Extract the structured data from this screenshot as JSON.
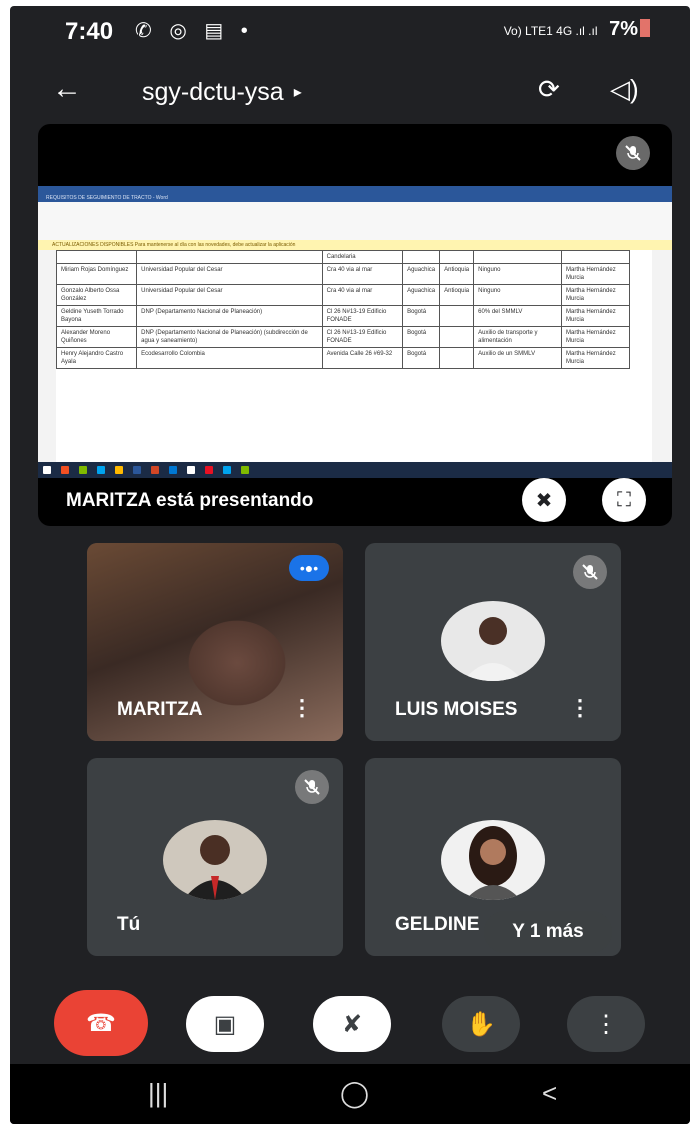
{
  "status_bar": {
    "time": "7:40",
    "left_icons": "✆ ◎ ▤ •",
    "network": "Vo) LTE1 4G .ıl .ıl",
    "battery": "7%"
  },
  "top_bar": {
    "meeting_code": "sgy-dctu-ysa",
    "code_arrow": "▸",
    "back_glyph": "←",
    "camera_switch_glyph": "⟳",
    "speaker_glyph": "◁)"
  },
  "presentation": {
    "label": "MARITZA está presentando",
    "shared_screen": {
      "ribbon_text": "REQUISITOS DE SEGUIMIENTO DE TRACTO - Word",
      "info_bar": "ACTUALIZACIONES DISPONIBLES  Para mantenerse al día con las novedades, debe actualizar la aplicación",
      "table_rows": [
        [
          "",
          "",
          "Candelaria",
          "",
          "",
          "",
          ""
        ],
        [
          "Miriam Rojas Domínguez",
          "Universidad Popular del Cesar",
          "Cra 40 via al mar",
          "Aguachica",
          "Antioquia",
          "Ninguno",
          "Martha Hernández Murcia"
        ],
        [
          "Gonzalo Alberto Ossa González",
          "Universidad Popular del Cesar",
          "Cra 40 via al mar",
          "Aguachica",
          "Antioquia",
          "Ninguno",
          "Martha Hernández Murcia"
        ],
        [
          "Geldine Yuseth Torrado Bayona",
          "DNP (Departamento Nacional de Planeación)",
          "Cl 26 N#13-19 Edificio FONADE",
          "Bogotá",
          "",
          "60% del SMMLV",
          "Martha Hernández Murcia"
        ],
        [
          "Alexander Moreno Quiñones",
          "DNP (Departamento Nacional de Planeación) (subdirección de agua y saneamiento)",
          "Cl 26 N#13-19 Edificio FONADE",
          "Bogotá",
          "",
          "Auxilio de transporte y alimentación",
          "Martha Hernández Murcia"
        ],
        [
          "Henry Alejandro Castro Ayala",
          "Ecodesarrollo Colombia",
          "Avenida Calle 26 #69-32",
          "Bogotá",
          "",
          "Auxilio de un SMMLV",
          "Martha Hernández Murcia"
        ]
      ]
    }
  },
  "participants": [
    {
      "name": "MARITZA",
      "muted": false,
      "speaking": true,
      "more_glyph": "⋮"
    },
    {
      "name": "LUIS MOISES",
      "muted": true,
      "speaking": false,
      "more_glyph": "⋮"
    },
    {
      "name": "Tú",
      "muted": true,
      "speaking": false,
      "more_glyph": ""
    },
    {
      "name": "GELDINE",
      "muted": false,
      "speaking": false,
      "more_glyph": ""
    }
  ],
  "more_participants": "Y 1 más",
  "controls": {
    "end_call": "☎",
    "camera": "▣",
    "mic": "✘",
    "raise_hand": "✋",
    "more": "⋮"
  },
  "nav_bar": {
    "recents": "|||",
    "home": "◯",
    "back": "<"
  },
  "colors": {
    "background": "#202124",
    "tile": "#3c4043",
    "end_call_red": "#ea4335",
    "speaking_blue": "#1a73e8",
    "word_blue": "#2b579a"
  }
}
